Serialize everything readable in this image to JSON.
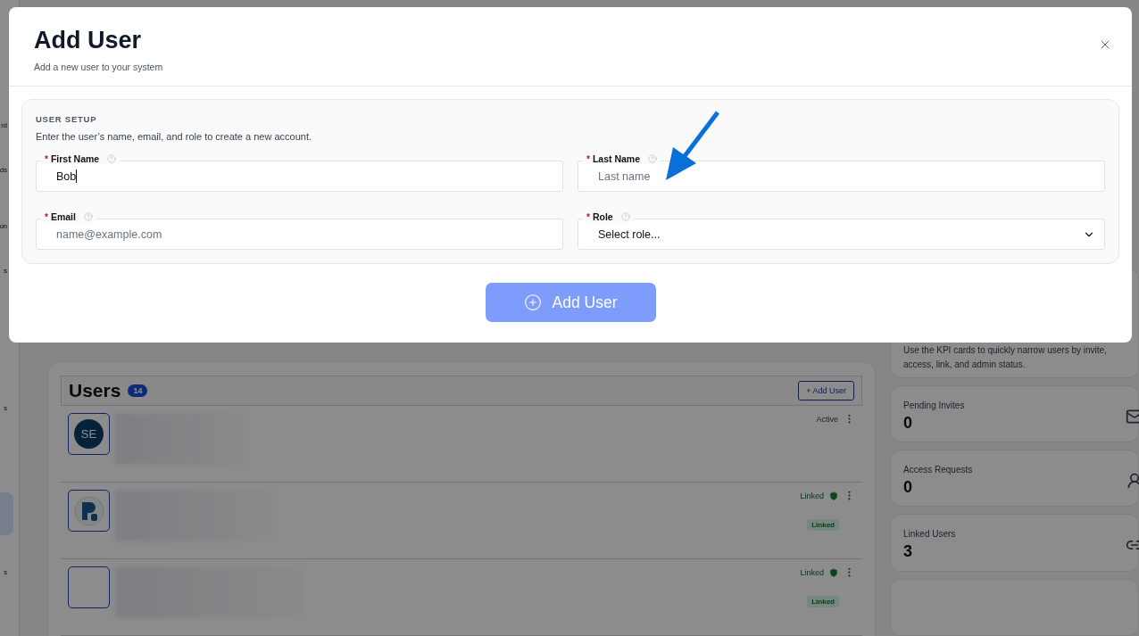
{
  "background": {
    "sidebar": {
      "items": [
        {
          "label": "rd",
          "selected": false
        },
        {
          "label": "ds",
          "selected": false
        },
        {
          "label": "on",
          "selected": false
        },
        {
          "label": "s",
          "selected": false
        },
        {
          "label": "s",
          "selected": false
        },
        {
          "selected": true
        },
        {
          "label": "s",
          "selected": false
        }
      ]
    },
    "users": {
      "title": "Users",
      "count": "14",
      "add_button": "+ Add User",
      "rows": [
        {
          "avatar": {
            "kind": "initials",
            "text": "SE"
          },
          "status": "Active",
          "verified": false
        },
        {
          "avatar": {
            "kind": "logo"
          },
          "status": "Linked",
          "verified": true,
          "tag": "Linked"
        },
        {
          "avatar": {
            "kind": "empty"
          },
          "status": "Linked",
          "verified": true,
          "tag": "Linked"
        }
      ]
    },
    "kpis": {
      "note": "Use the KPI cards to quickly narrow users by invite, access, link, and admin status.",
      "cards": [
        {
          "label": "Pending Invites",
          "value": "0"
        },
        {
          "label": "Access Requests",
          "value": "0"
        },
        {
          "label": "Linked Users",
          "value": "3"
        }
      ]
    }
  },
  "dialog": {
    "title": "Add User",
    "subtitle": "Add a new user to your system",
    "section": {
      "heading": "USER SETUP",
      "description": "Enter the user’s name, email, and role to create a new account.",
      "fields": [
        {
          "kind": "text",
          "marker": "*",
          "label": "First Name",
          "value": "Bob",
          "focused": true
        },
        {
          "kind": "text",
          "marker": "*",
          "label": "Last Name",
          "placeholder": "Last name",
          "focused": false
        },
        {
          "kind": "text",
          "marker": "*",
          "label": "Email",
          "placeholder": "name@example.com",
          "focused": false
        },
        {
          "kind": "select",
          "marker": "*",
          "label": "Role",
          "value": "Select role..."
        }
      ]
    },
    "submit": {
      "label": "Add User",
      "disabled": true
    }
  }
}
